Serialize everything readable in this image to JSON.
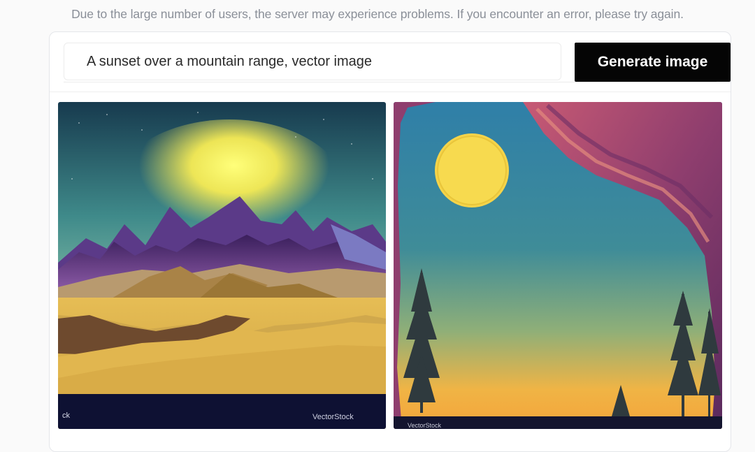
{
  "notice": {
    "text": "Due to the large number of users, the server may experience problems. If you encounter an error, please try again."
  },
  "prompt": {
    "value": "A sunset over a mountain range, vector image",
    "button_label": "Generate image"
  },
  "results": [
    {
      "subject": "mountain range at sunset",
      "watermark_left": "ck",
      "watermark_right": "VectorStock"
    },
    {
      "subject": "sun over forest with rock arch",
      "watermark_bottom": "VectorStock"
    }
  ],
  "colors": {
    "button_bg": "#050505",
    "notice_text": "#8a8f98"
  }
}
